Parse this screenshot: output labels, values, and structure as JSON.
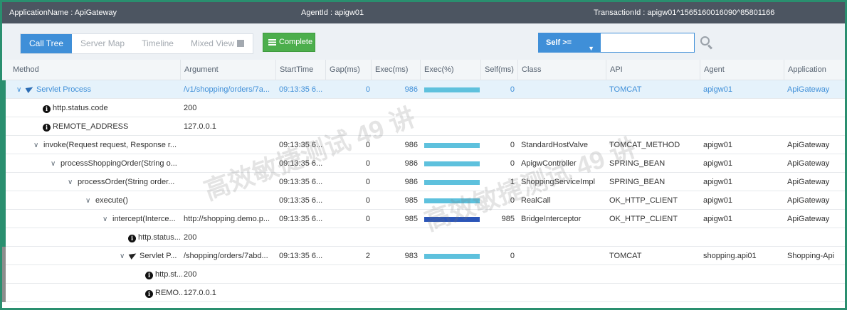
{
  "topbar": {
    "application": "ApplicationName : ApiGateway",
    "agent": "AgentId : apigw01",
    "transaction": "TransactionId : apigw01^1565160016090^85801166"
  },
  "tabs": [
    {
      "label": "Call Tree",
      "active": true
    },
    {
      "label": "Server Map",
      "active": false
    },
    {
      "label": "Timeline",
      "active": false
    },
    {
      "label": "Mixed View",
      "active": false
    }
  ],
  "complete_label": "Complete",
  "filter": {
    "selected": "Self >=",
    "value": "",
    "placeholder": ""
  },
  "columns": [
    "Method",
    "Argument",
    "StartTime",
    "Gap(ms)",
    "Exec(ms)",
    "Exec(%)",
    "Self(ms)",
    "Class",
    "API",
    "Agent",
    "Application"
  ],
  "rows": [
    {
      "method": "Servlet Process",
      "argument": "/v1/shopping/orders/7a...",
      "start": "09:13:35 6...",
      "gap": "0",
      "exec": "986",
      "exec_pct": 1.0,
      "self": "0",
      "class": "",
      "api": "TOMCAT",
      "agent": "apigw01",
      "application": "ApiGateway"
    },
    {
      "method": "http.status.code",
      "argument": "200",
      "start": "",
      "gap": "",
      "exec": "",
      "self": "",
      "class": "",
      "api": "",
      "agent": "",
      "application": ""
    },
    {
      "method": "REMOTE_ADDRESS",
      "argument": "127.0.0.1",
      "start": "",
      "gap": "",
      "exec": "",
      "self": "",
      "class": "",
      "api": "",
      "agent": "",
      "application": ""
    },
    {
      "method": "invoke(Request request, Response r...",
      "argument": "",
      "start": "09:13:35 6...",
      "gap": "0",
      "exec": "986",
      "exec_pct": 1.0,
      "self": "0",
      "class": "StandardHostValve",
      "api": "TOMCAT_METHOD",
      "agent": "apigw01",
      "application": "ApiGateway"
    },
    {
      "method": "processShoppingOrder(String o...",
      "argument": "",
      "start": "09:13:35 6...",
      "gap": "0",
      "exec": "986",
      "exec_pct": 1.0,
      "self": "0",
      "class": "ApigwController",
      "api": "SPRING_BEAN",
      "agent": "apigw01",
      "application": "ApiGateway"
    },
    {
      "method": "processOrder(String order...",
      "argument": "",
      "start": "09:13:35 6...",
      "gap": "0",
      "exec": "986",
      "exec_pct": 1.0,
      "self": "1",
      "class": "ShoppingServiceImpl",
      "api": "SPRING_BEAN",
      "agent": "apigw01",
      "application": "ApiGateway"
    },
    {
      "method": "execute()",
      "argument": "",
      "start": "09:13:35 6...",
      "gap": "0",
      "exec": "985",
      "exec_pct": 1.0,
      "self": "0",
      "class": "RealCall",
      "api": "OK_HTTP_CLIENT",
      "agent": "apigw01",
      "application": "ApiGateway"
    },
    {
      "method": "intercept(Interce...",
      "argument": "http://shopping.demo.p...",
      "start": "09:13:35 6...",
      "gap": "0",
      "exec": "985",
      "exec_pct": 1.0,
      "self": "985",
      "class": "BridgeInterceptor",
      "api": "OK_HTTP_CLIENT",
      "agent": "apigw01",
      "application": "ApiGateway"
    },
    {
      "method": "http.status...",
      "argument": "200",
      "start": "",
      "gap": "",
      "exec": "",
      "self": "",
      "class": "",
      "api": "",
      "agent": "",
      "application": ""
    },
    {
      "method": "Servlet P...",
      "argument": "/shopping/orders/7abd...",
      "start": "09:13:35 6...",
      "gap": "2",
      "exec": "983",
      "exec_pct": 1.0,
      "self": "0",
      "class": "",
      "api": "TOMCAT",
      "agent": "shopping.api01",
      "application": "Shopping-Api"
    },
    {
      "method": "http.st...",
      "argument": "200",
      "start": "",
      "gap": "",
      "exec": "",
      "self": "",
      "class": "",
      "api": "",
      "agent": "",
      "application": ""
    },
    {
      "method": "REMO...",
      "argument": "127.0.0.1",
      "start": "",
      "gap": "",
      "exec": "",
      "self": "",
      "class": "",
      "api": "",
      "agent": "",
      "application": ""
    }
  ],
  "watermark": "高效敏捷测试 49 讲",
  "colors": {
    "accent": "#3f8fd8",
    "complete": "#4cae4c",
    "topbar": "#4c5561",
    "bar": "#5ec1dd",
    "bar_self": "#2b55b8",
    "frame": "#2a8f6f"
  }
}
